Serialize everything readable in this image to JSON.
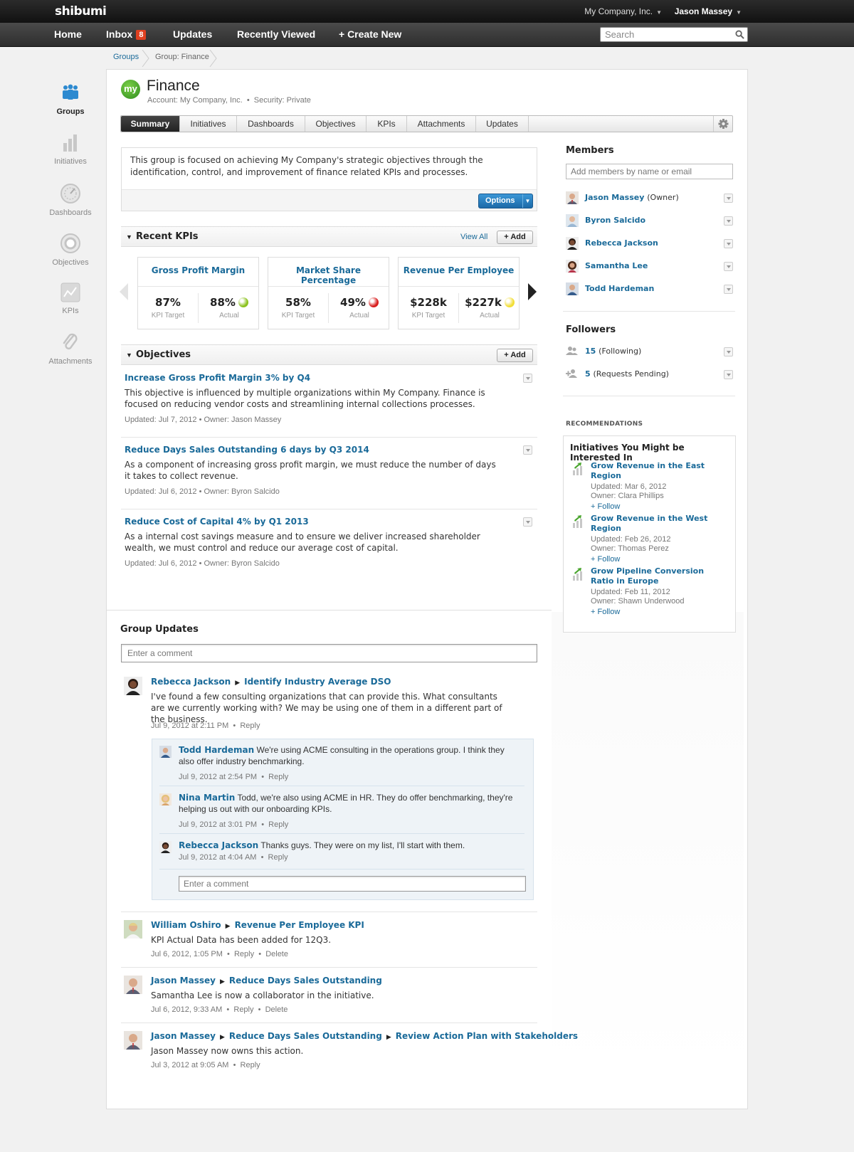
{
  "topbar": {
    "logo": "shibumi",
    "company": "My Company, Inc.",
    "user": "Jason Massey"
  },
  "nav": {
    "home": "Home",
    "inbox": "Inbox",
    "inbox_count": "8",
    "updates": "Updates",
    "recent": "Recently Viewed",
    "create": "+ Create New",
    "search_placeholder": "Search"
  },
  "breadcrumb": {
    "root": "Groups",
    "current": "Group: Finance"
  },
  "rail": [
    {
      "label": "Groups",
      "icon": "groups-icon"
    },
    {
      "label": "Initiatives",
      "icon": "initiatives-icon"
    },
    {
      "label": "Dashboards",
      "icon": "dashboards-icon"
    },
    {
      "label": "Objectives",
      "icon": "objectives-icon"
    },
    {
      "label": "KPIs",
      "icon": "kpis-icon"
    },
    {
      "label": "Attachments",
      "icon": "attachments-icon"
    }
  ],
  "group": {
    "badge": "my",
    "title": "Finance",
    "account": "Account: My Company, Inc.",
    "sep": "•",
    "security": "Security: Private"
  },
  "tabs": [
    "Summary",
    "Initiatives",
    "Dashboards",
    "Objectives",
    "KPIs",
    "Attachments",
    "Updates"
  ],
  "description": {
    "text": "This group is focused on achieving My Company's strategic objectives through the identification, control, and improvement of finance related KPIs and processes.",
    "options": "Options"
  },
  "recent_kpis": {
    "title": "Recent KPIs",
    "view_all": "View All",
    "add": "+ Add",
    "cards": [
      {
        "name": "Gross Profit Margin",
        "target": "87%",
        "target_label": "KPI Target",
        "actual": "88%",
        "actual_label": "Actual",
        "status_color": "#8cc21f"
      },
      {
        "name": "Market Share Percentage",
        "target": "58%",
        "target_label": "KPI Target",
        "actual": "49%",
        "actual_label": "Actual",
        "status_color": "#d81e1e"
      },
      {
        "name": "Revenue Per Employee",
        "target": "$228k",
        "target_label": "KPI Target",
        "actual": "$227k",
        "actual_label": "Actual",
        "status_color": "#f2de36"
      }
    ]
  },
  "objectives": {
    "title": "Objectives",
    "add": "+ Add",
    "items": [
      {
        "title": "Increase Gross Profit Margin 3% by Q4",
        "desc": "This objective is influenced by multiple organizations within My Company. Finance is focused on reducing vendor costs and streamlining internal collections processes.",
        "meta": "Updated: Jul 7, 2012  •  Owner: Jason Massey"
      },
      {
        "title": "Reduce Days Sales Outstanding 6 days by Q3 2014",
        "desc": "As a component of increasing gross profit margin, we must reduce the number of days it takes to collect revenue.",
        "meta": "Updated: Jul 6, 2012  •  Owner: Byron Salcido"
      },
      {
        "title": "Reduce Cost of Capital 4% by Q1 2013",
        "desc": "As a internal cost savings measure and to ensure we deliver increased shareholder wealth, we must control and reduce our average cost of capital.",
        "meta": "Updated: Jul 6, 2012  •  Owner: Byron Salcido"
      }
    ]
  },
  "members": {
    "title": "Members",
    "placeholder": "Add members by name or email",
    "items": [
      {
        "name": "Jason Massey",
        "role": "(Owner)"
      },
      {
        "name": "Byron Salcido",
        "role": ""
      },
      {
        "name": "Rebecca Jackson",
        "role": ""
      },
      {
        "name": "Samantha Lee",
        "role": ""
      },
      {
        "name": "Todd Hardeman",
        "role": ""
      }
    ]
  },
  "followers": {
    "title": "Followers",
    "following_count": "15",
    "following_label": "(Following)",
    "pending_count": "5",
    "pending_label": "(Requests Pending)"
  },
  "recommendations": {
    "heading": "RECOMMENDATIONS",
    "title": "Initiatives You Might be Interested In",
    "items": [
      {
        "title": "Grow Revenue in the East Region",
        "updated": "Updated: Mar 6, 2012",
        "owner": "Owner: Clara Phillips",
        "follow": "+ Follow"
      },
      {
        "title": "Grow Revenue in the West Region",
        "updated": "Updated: Feb 26, 2012",
        "owner": "Owner: Thomas Perez",
        "follow": "+ Follow"
      },
      {
        "title": "Grow Pipeline Conversion Ratio in Europe",
        "updated": "Updated: Feb 11, 2012",
        "owner": "Owner: Shawn Underwood",
        "follow": "+ Follow"
      }
    ]
  },
  "updates": {
    "title": "Group Updates",
    "comment_placeholder": "Enter a comment",
    "first": {
      "author": "Rebecca Jackson",
      "target": "Identify Industry Average DSO",
      "body": "I've found a few consulting organizations that can provide this. What consultants are we currently working with? We may be using one of them in a different part of the business.",
      "time": "Jul 9, 2012 at 2:11 PM",
      "reply": "Reply",
      "replies": [
        {
          "author": "Todd Hardeman",
          "text": "We're using ACME consulting in the operations group. I think they also offer industry benchmarking.",
          "time": "Jul 9, 2012 at 2:54 PM",
          "reply": "Reply"
        },
        {
          "author": "Nina Martin",
          "text": "Todd, we're also using ACME in HR. They do offer benchmarking, they're helping us out with our onboarding KPIs.",
          "time": "Jul 9, 2012 at 3:01 PM",
          "reply": "Reply"
        },
        {
          "author": "Rebecca Jackson",
          "text": " Thanks guys. They were on my list, I'll start with them.",
          "time": "Jul 9, 2012 at 4:04 AM",
          "reply": "Reply"
        }
      ],
      "reply_placeholder": "Enter a comment"
    },
    "others": [
      {
        "author": "William Oshiro",
        "targets": [
          "Revenue Per Employee KPI"
        ],
        "body": "KPI Actual Data has been added for 12Q3.",
        "time": "Jul 6, 2012, 1:05 PM",
        "reply": "Reply",
        "delete": "Delete"
      },
      {
        "author": "Jason Massey",
        "targets": [
          "Reduce Days Sales Outstanding"
        ],
        "body": "Samantha Lee is now a collaborator in the initiative.",
        "time": "Jul 6, 2012, 9:33 AM",
        "reply": "Reply",
        "delete": "Delete"
      },
      {
        "author": "Jason Massey",
        "targets": [
          "Reduce Days Sales Outstanding",
          "Review Action Plan with Stakeholders"
        ],
        "body": "Jason Massey now owns this action.",
        "time": "Jul 3, 2012 at 9:05 AM",
        "reply": "Reply",
        "delete": ""
      }
    ]
  }
}
